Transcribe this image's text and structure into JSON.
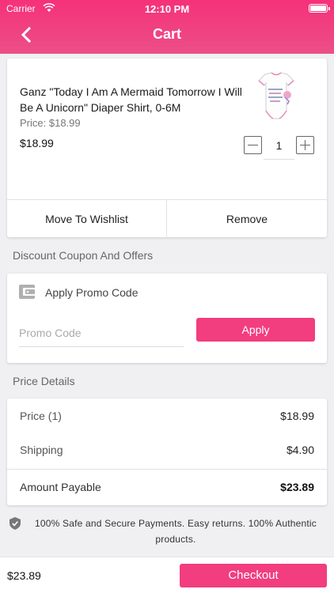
{
  "status_bar": {
    "carrier": "Carrier",
    "time": "12:10 PM"
  },
  "header": {
    "title": "Cart",
    "back_icon": "chevron-left-icon"
  },
  "theme": {
    "accent": "#f23d7f",
    "header": "#f5317a"
  },
  "cart_item": {
    "title": "Ganz \"Today I Am A Mermaid Tomorrow I Will Be A Unicorn\" Diaper Shirt, 0-6M",
    "price_label": "Price:",
    "price_value": "$18.99",
    "line_total": "$18.99",
    "quantity": "1",
    "move_to_wishlist": "Move To Wishlist",
    "remove": "Remove"
  },
  "coupon": {
    "section_title": "Discount Coupon And Offers",
    "heading": "Apply Promo Code",
    "input_placeholder": "Promo Code",
    "input_value": "",
    "apply_label": "Apply"
  },
  "price_details": {
    "section_title": "Price Details",
    "rows": [
      {
        "label": "Price (1)",
        "value": "$18.99"
      },
      {
        "label": "Shipping",
        "value": "$4.90"
      }
    ],
    "total": {
      "label": "Amount Payable",
      "value": "$23.89"
    }
  },
  "secure_note": "100% Safe and Secure Payments. Easy returns. 100% Authentic products.",
  "footer": {
    "total": "$23.89",
    "checkout_label": "Checkout"
  }
}
